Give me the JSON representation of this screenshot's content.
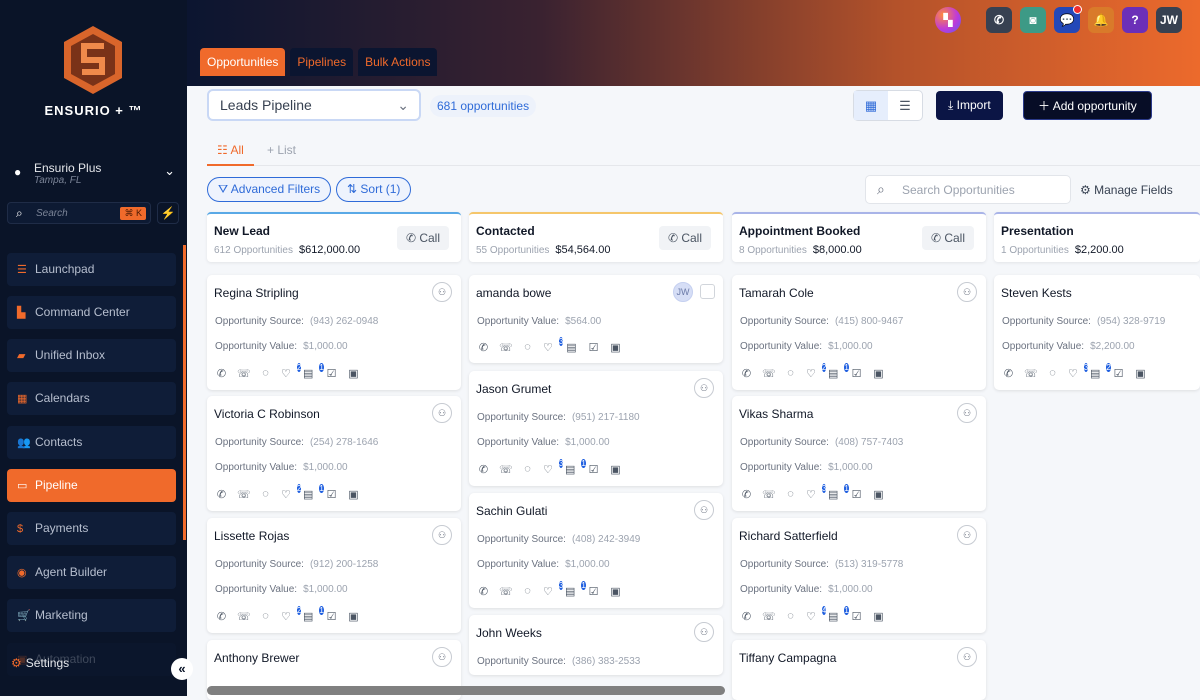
{
  "sidebar": {
    "brand": "ENSURIO + ™",
    "location": {
      "name": "Ensurio Plus",
      "city": "Tampa, FL"
    },
    "search_placeholder": "Search",
    "shortcut": "⌘ K",
    "items": [
      {
        "label": "Launchpad",
        "icon": "launchpad-icon"
      },
      {
        "label": "Command Center",
        "icon": "chart-icon"
      },
      {
        "label": "Unified Inbox",
        "icon": "inbox-icon"
      },
      {
        "label": "Calendars",
        "icon": "calendar-icon"
      },
      {
        "label": "Contacts",
        "icon": "contacts-icon"
      },
      {
        "label": "Pipeline",
        "icon": "pipeline-icon",
        "active": true
      },
      {
        "label": "Payments",
        "icon": "dollar-icon"
      },
      {
        "label": "Agent Builder",
        "icon": "robot-icon"
      },
      {
        "label": "Marketing",
        "icon": "cart-icon"
      },
      {
        "label": "Automation",
        "icon": "automation-icon"
      }
    ],
    "settings": "Settings"
  },
  "header": {
    "tabs": [
      "Opportunities",
      "Pipelines",
      "Bulk Actions"
    ],
    "user_initials": "JW",
    "accent": "#f06a2b"
  },
  "toolbar": {
    "pipeline": "Leads Pipeline",
    "count": "681 opportunities",
    "import": "Import",
    "add": "Add opportunity",
    "view_all": "All",
    "view_list": "List",
    "advanced_filters": "Advanced Filters",
    "sort": "Sort (1)",
    "search_placeholder": "Search Opportunities",
    "manage_fields": "Manage Fields"
  },
  "labels": {
    "source": "Opportunity Source:",
    "value": "Opportunity Value:",
    "call": "Call"
  },
  "columns": [
    {
      "title": "New Lead",
      "count": "612 Opportunities",
      "total": "$612,000.00",
      "color": "#5aa9e6",
      "cards": [
        {
          "name": "Regina Stripling",
          "source": "(943) 262-0948",
          "value": "$1,000.00",
          "tags": "2",
          "notes": "1"
        },
        {
          "name": "Victoria C Robinson",
          "source": "(254) 278-1646",
          "value": "$1,000.00",
          "tags": "2",
          "notes": "1"
        },
        {
          "name": "Lissette Rojas",
          "source": "(912) 200-1258",
          "value": "$1,000.00",
          "tags": "2",
          "notes": "1"
        },
        {
          "name": "Anthony Brewer",
          "source": "",
          "value": ""
        }
      ]
    },
    {
      "title": "Contacted",
      "count": "55 Opportunities",
      "total": "$54,564.00",
      "color": "#f5c66b",
      "cards": [
        {
          "name": "amanda bowe",
          "assignee": "JW",
          "value": "$564.00",
          "tags": "3"
        },
        {
          "name": "Jason Grumet",
          "source": "(951) 217-1180",
          "value": "$1,000.00",
          "tags": "3",
          "notes": "1"
        },
        {
          "name": "Sachin Gulati",
          "source": "(408) 242-3949",
          "value": "$1,000.00",
          "tags": "3",
          "notes": "1"
        },
        {
          "name": "John Weeks",
          "source": "(386) 383-2533",
          "value": ""
        }
      ]
    },
    {
      "title": "Appointment Booked",
      "count": "8 Opportunities",
      "total": "$8,000.00",
      "color": "#a9b4e8",
      "cards": [
        {
          "name": "Tamarah Cole",
          "source": "(415) 800-9467",
          "value": "$1,000.00",
          "tags": "2",
          "notes": "1"
        },
        {
          "name": "Vikas Sharma",
          "source": "(408) 757-7403",
          "value": "$1,000.00",
          "tags": "3",
          "notes": "1"
        },
        {
          "name": "Richard Satterfield",
          "source": "(513) 319-5778",
          "value": "$1,000.00",
          "tags": "4",
          "notes": "1"
        },
        {
          "name": "Tiffany Campagna",
          "source": "",
          "value": ""
        }
      ]
    },
    {
      "title": "Presentation",
      "count": "1 Opportunities",
      "total": "$2,200.00",
      "color": "#a9b4e8",
      "cards": [
        {
          "name": "Steven Kests",
          "source": "(954) 328-9719",
          "value": "$2,200.00",
          "tags": "3",
          "notes": "2"
        }
      ]
    }
  ]
}
